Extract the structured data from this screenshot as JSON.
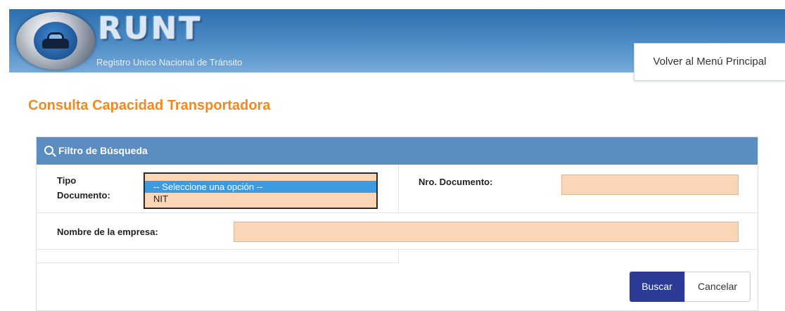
{
  "header": {
    "logo_title": "RUNT",
    "logo_subtitle": "Registro Unico Nacional de Tránsito",
    "menu_button": "Volver al Menú Principal"
  },
  "page": {
    "title": "Consulta Capacidad Transportadora"
  },
  "filter": {
    "panel_title": "Filtro de Búsqueda",
    "tipo_documento_label_1": "Tipo",
    "tipo_documento_label_2": "Documento:",
    "tipo_documento_options": [
      "-- Seleccione una opción --",
      "NIT"
    ],
    "nro_documento_label": "Nro. Documento:",
    "nro_documento_value": "",
    "nombre_empresa_label": "Nombre de la empresa:",
    "nombre_empresa_value": ""
  },
  "actions": {
    "search": "Buscar",
    "cancel": "Cancelar"
  },
  "colors": {
    "title_orange": "#f08a24",
    "panel_header": "#5b8dc0",
    "input_fill": "#fbd6b6",
    "primary_button": "#2b3a94",
    "selected_option": "#3c9be0"
  }
}
